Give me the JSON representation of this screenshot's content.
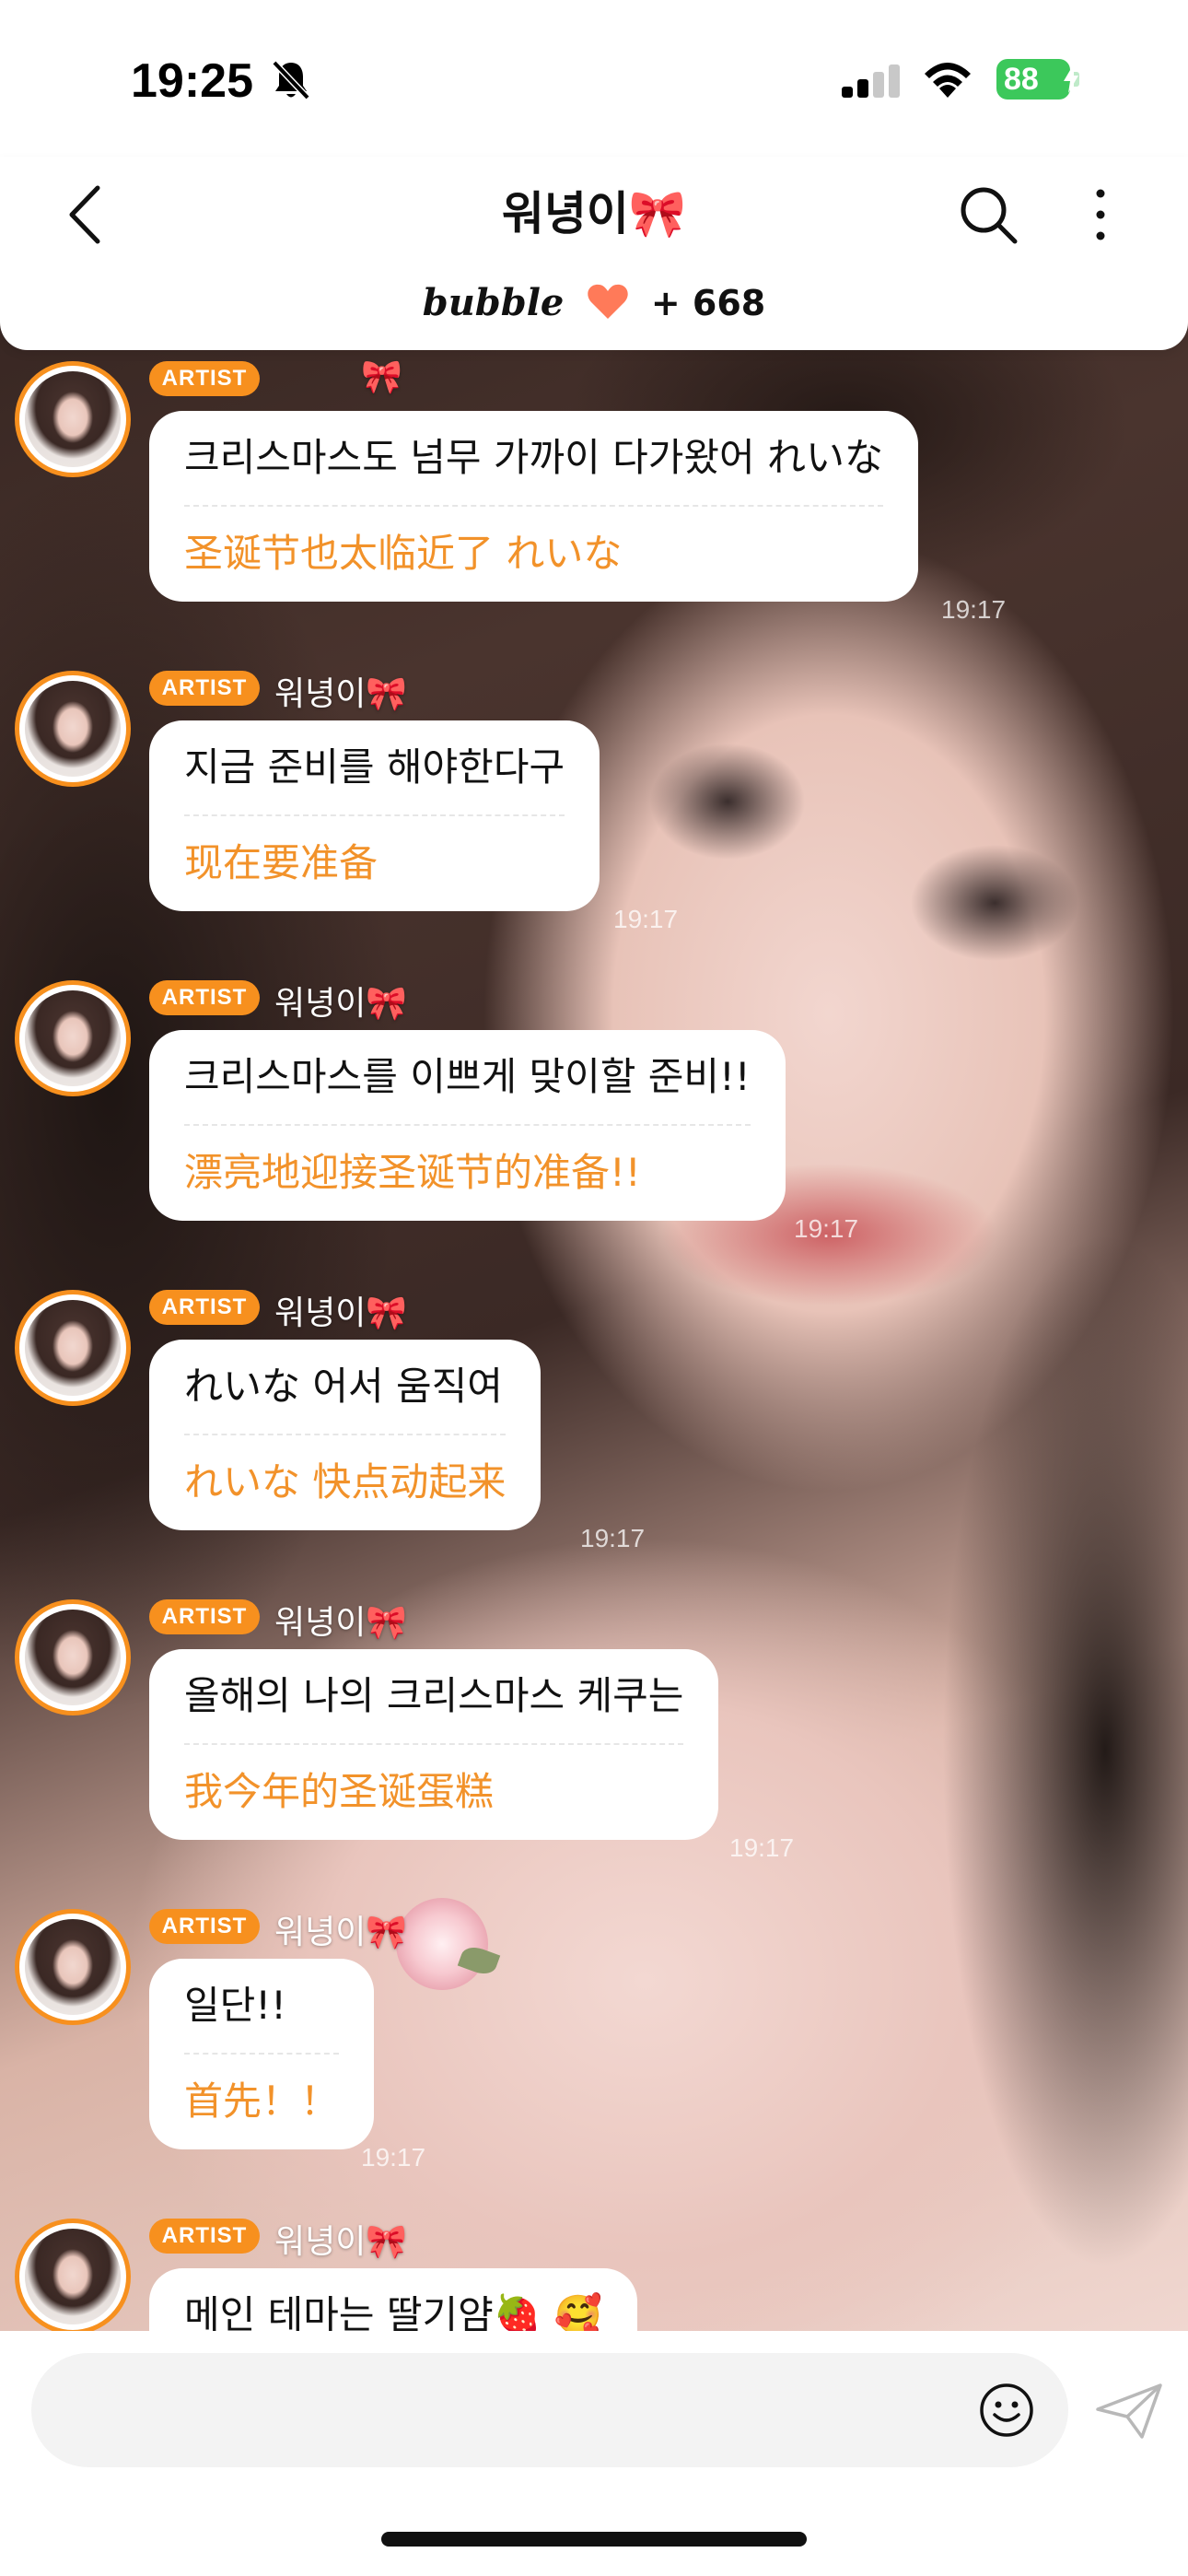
{
  "status_bar": {
    "time": "19:25",
    "battery": "88"
  },
  "header": {
    "title": "워녕이🎀",
    "bubble_brand": "bubble",
    "bubble_count": "+ 668"
  },
  "messages": [
    {
      "badge": "ARTIST",
      "sender": "",
      "sender_bow": "🎀",
      "korean": "크리스마스도 넘무 가까이 다가왔어 れいな",
      "chinese": "圣诞节也太临近了 れいな",
      "time": "19:17"
    },
    {
      "badge": "ARTIST",
      "sender": "워녕이",
      "sender_bow": "🎀",
      "korean": "지금 준비를 해야한다구",
      "chinese": "现在要准备",
      "time": "19:17"
    },
    {
      "badge": "ARTIST",
      "sender": "워녕이",
      "sender_bow": "🎀",
      "korean": "크리스마스를 이쁘게 맞이할 준비!!",
      "chinese": "漂亮地迎接圣诞节的准备!!",
      "time": "19:17"
    },
    {
      "badge": "ARTIST",
      "sender": "워녕이",
      "sender_bow": "🎀",
      "korean": "れいな 어서 움직여",
      "chinese": "れいな 快点动起来",
      "time": "19:17"
    },
    {
      "badge": "ARTIST",
      "sender": "워녕이",
      "sender_bow": "🎀",
      "korean": "올해의 나의 크리스마스 케쿠는",
      "chinese": "我今年的圣诞蛋糕",
      "time": "19:17"
    },
    {
      "badge": "ARTIST",
      "sender": "워녕이",
      "sender_bow": "🎀",
      "korean": "일단!!",
      "chinese": "首先！！",
      "time": "19:17"
    },
    {
      "badge": "ARTIST",
      "sender": "워녕이",
      "sender_bow": "🎀",
      "korean": "메인 테마는 딸기얌🍓 🥰",
      "chinese": "",
      "time": ""
    }
  ],
  "input": {
    "placeholder": "",
    "value": ""
  },
  "colors": {
    "accent": "#f7901e",
    "translation_text": "#f2922a",
    "battery": "#3cc85b"
  },
  "icons": [
    "bell-off-icon",
    "signal-icon",
    "wifi-icon",
    "battery-icon",
    "back-icon",
    "search-icon",
    "more-icon",
    "heart-icon",
    "emoji-icon",
    "send-icon"
  ]
}
